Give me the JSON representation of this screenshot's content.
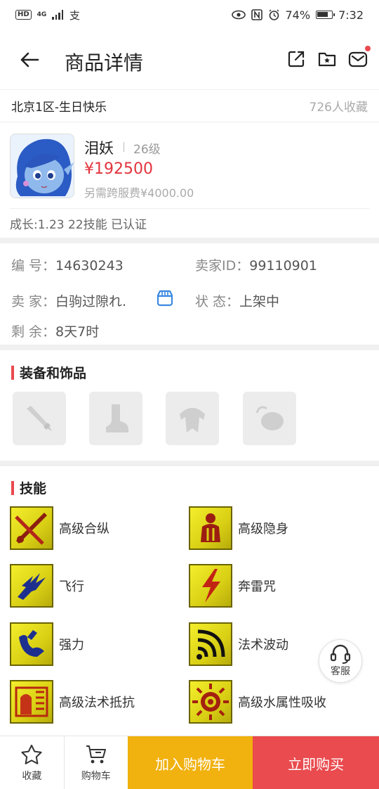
{
  "status_bar": {
    "hd": "HD",
    "network": "4G",
    "battery": "74%",
    "time": "7:32"
  },
  "nav": {
    "title": "商品详情"
  },
  "server": {
    "name": "北京1区-生日快乐",
    "favorites": "726人收藏"
  },
  "character": {
    "name": "泪妖",
    "level": "26级",
    "price": "¥192500",
    "extra_fee": "另需跨服费¥4000.00",
    "growth": "成长:1.23 22技能 已认证"
  },
  "info": {
    "id_label": "编  号：",
    "id_value": "14630243",
    "seller_id_label": "卖家ID：",
    "seller_id_value": "99110901",
    "seller_label": "卖  家：",
    "seller_value": "白驹过隙れ.",
    "state_label": "状  态：",
    "state_value": "上架中",
    "remain_label": "剩  余：",
    "remain_value": "8天7时"
  },
  "equipment": {
    "title": "装备和饰品",
    "slots": [
      "weapon-icon",
      "boots-icon",
      "armor-icon",
      "accessory-icon"
    ]
  },
  "skills": {
    "title": "技能",
    "items": [
      {
        "label": "高级合纵"
      },
      {
        "label": "高级隐身"
      },
      {
        "label": "飞行"
      },
      {
        "label": "奔雷咒"
      },
      {
        "label": "强力"
      },
      {
        "label": "法术波动"
      },
      {
        "label": "高级法术抵抗"
      },
      {
        "label": "高级水属性吸收"
      }
    ]
  },
  "customer_service": "客服",
  "bottom": {
    "favorite": "收藏",
    "cart": "购物车",
    "add_to_cart": "加入购物车",
    "buy_now": "立即购买"
  },
  "colors": {
    "accent_red": "#e94b4f",
    "cart_yellow": "#f1b10f",
    "price_red": "#e2343d"
  }
}
